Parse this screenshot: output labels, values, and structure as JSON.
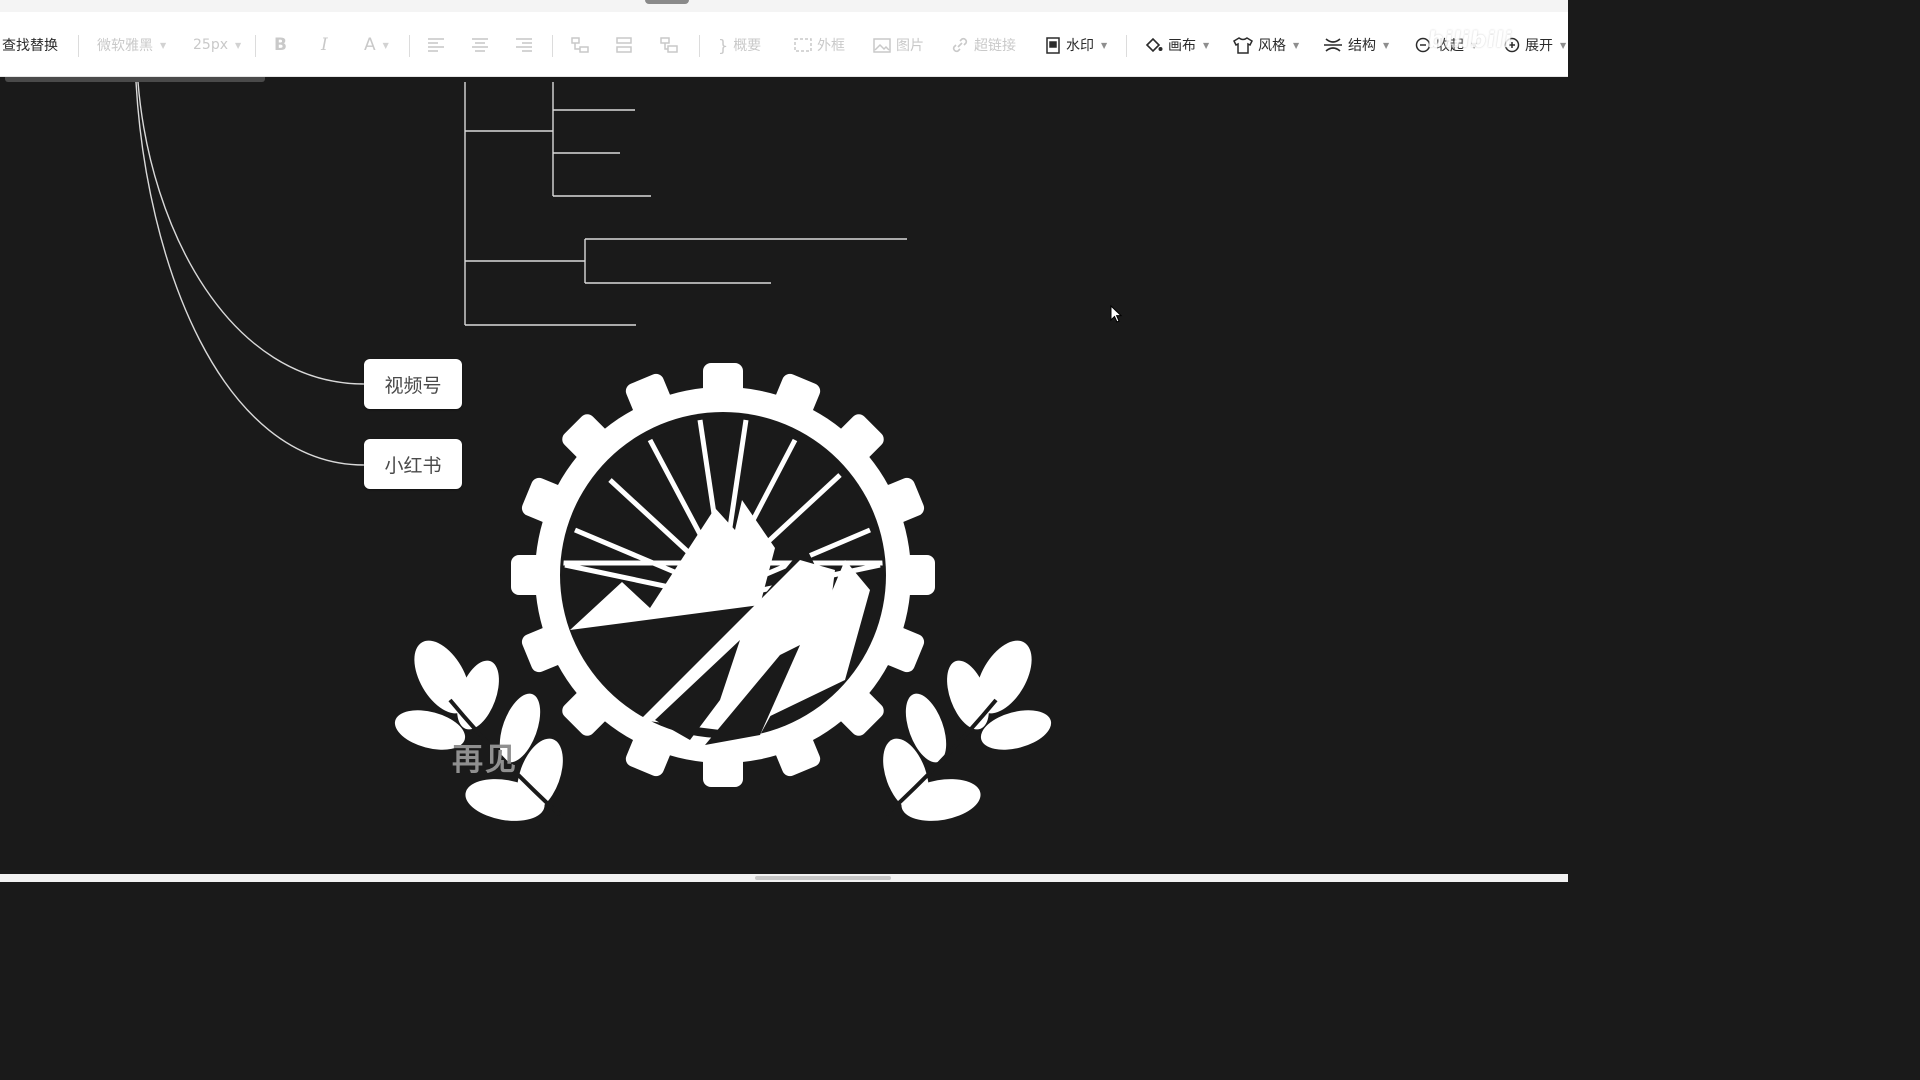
{
  "toolbar": {
    "find_replace": "查找替换",
    "font_family": "微软雅黑",
    "font_size": "25px",
    "bold": "B",
    "italic": "I",
    "font_color": "A",
    "summary": "概要",
    "boundary": "外框",
    "image": "图片",
    "hyperlink": "超链接",
    "watermark": "水印",
    "canvas": "画布",
    "style": "风格",
    "structure": "结构",
    "collapse": "收起",
    "expand": "展开"
  },
  "watermark_text": "bilibili",
  "mindmap": {
    "nodes": [
      {
        "label": "视频号"
      },
      {
        "label": "小红书"
      }
    ]
  },
  "overlay": {
    "goodbye_text": "再见"
  },
  "colors": {
    "canvas_bg": "#1a1a1a",
    "toolbar_bg": "#ffffff",
    "node_bg": "#ffffff",
    "connector": "#d9d9d9",
    "disabled_text": "#c9c9c9"
  }
}
